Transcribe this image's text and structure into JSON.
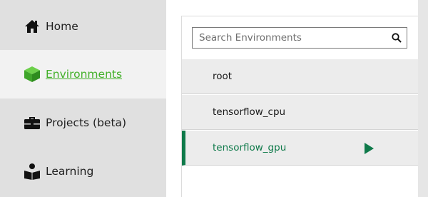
{
  "sidebar": {
    "items": [
      {
        "label": "Home",
        "icon": "home-icon"
      },
      {
        "label": "Environments",
        "icon": "cube-icon",
        "active": true
      },
      {
        "label": "Projects (beta)",
        "icon": "briefcase-icon"
      },
      {
        "label": "Learning",
        "icon": "book-reader-icon"
      }
    ]
  },
  "environments": {
    "search_placeholder": "Search Environments",
    "search_value": "",
    "list": [
      {
        "name": "root"
      },
      {
        "name": "tensorflow_cpu"
      },
      {
        "name": "tensorflow_gpu",
        "selected": true
      }
    ]
  },
  "colors": {
    "accent_green": "#43b02a",
    "selected_green": "#0f7a4a",
    "sidebar_bg": "#e0e0e0"
  }
}
